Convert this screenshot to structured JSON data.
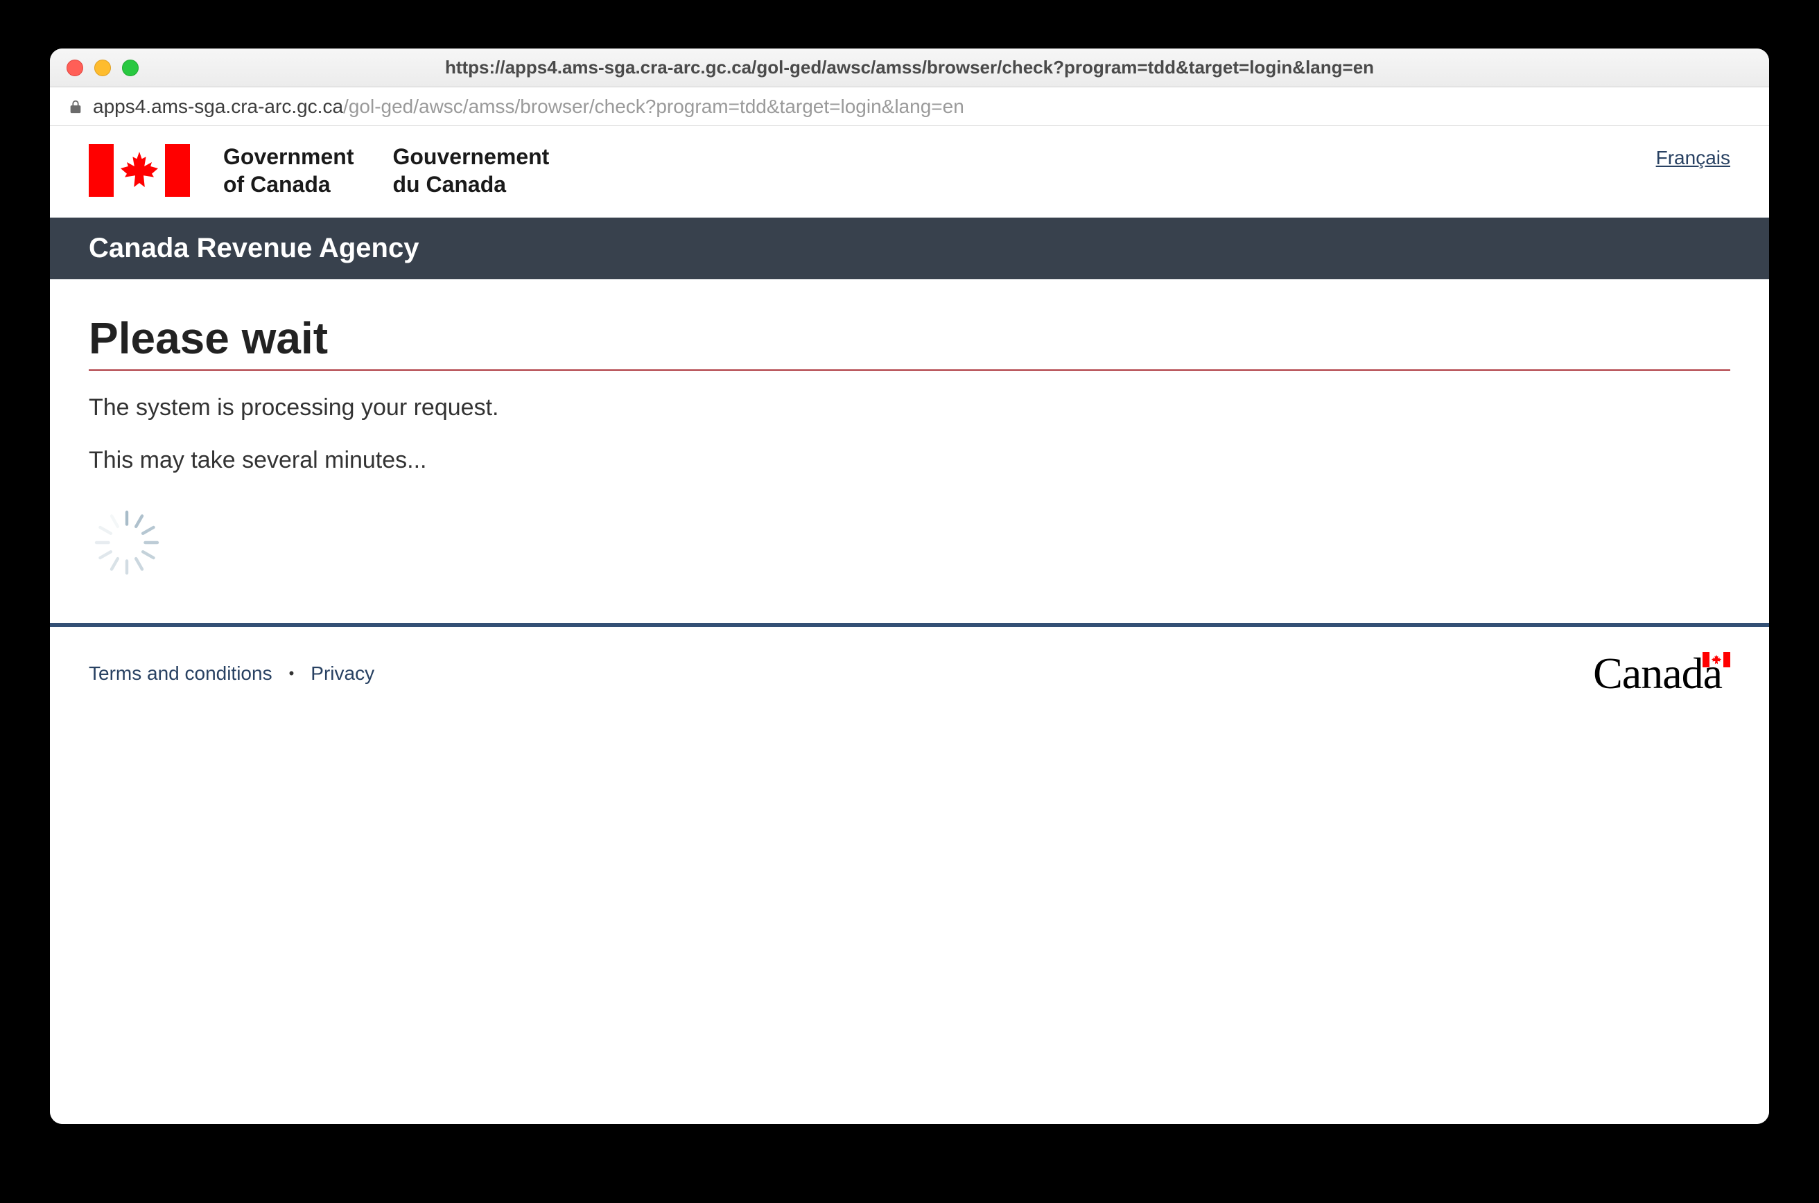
{
  "browser": {
    "title": "https://apps4.ams-sga.cra-arc.gc.ca/gol-ged/awsc/amss/browser/check?program=tdd&target=login&lang=en",
    "url_host": "apps4.ams-sga.cra-arc.gc.ca",
    "url_path": "/gol-ged/awsc/amss/browser/check?program=tdd&target=login&lang=en"
  },
  "header": {
    "lang_toggle": "Français",
    "gov_en_line1": "Government",
    "gov_en_line2": "of Canada",
    "gov_fr_line1": "Gouvernement",
    "gov_fr_line2": "du Canada"
  },
  "agency_bar": "Canada Revenue Agency",
  "main": {
    "title": "Please wait",
    "line1": "The system is processing your request.",
    "line2": "This may take several minutes..."
  },
  "footer": {
    "terms": "Terms and conditions",
    "privacy": "Privacy",
    "wordmark": "Canada"
  }
}
